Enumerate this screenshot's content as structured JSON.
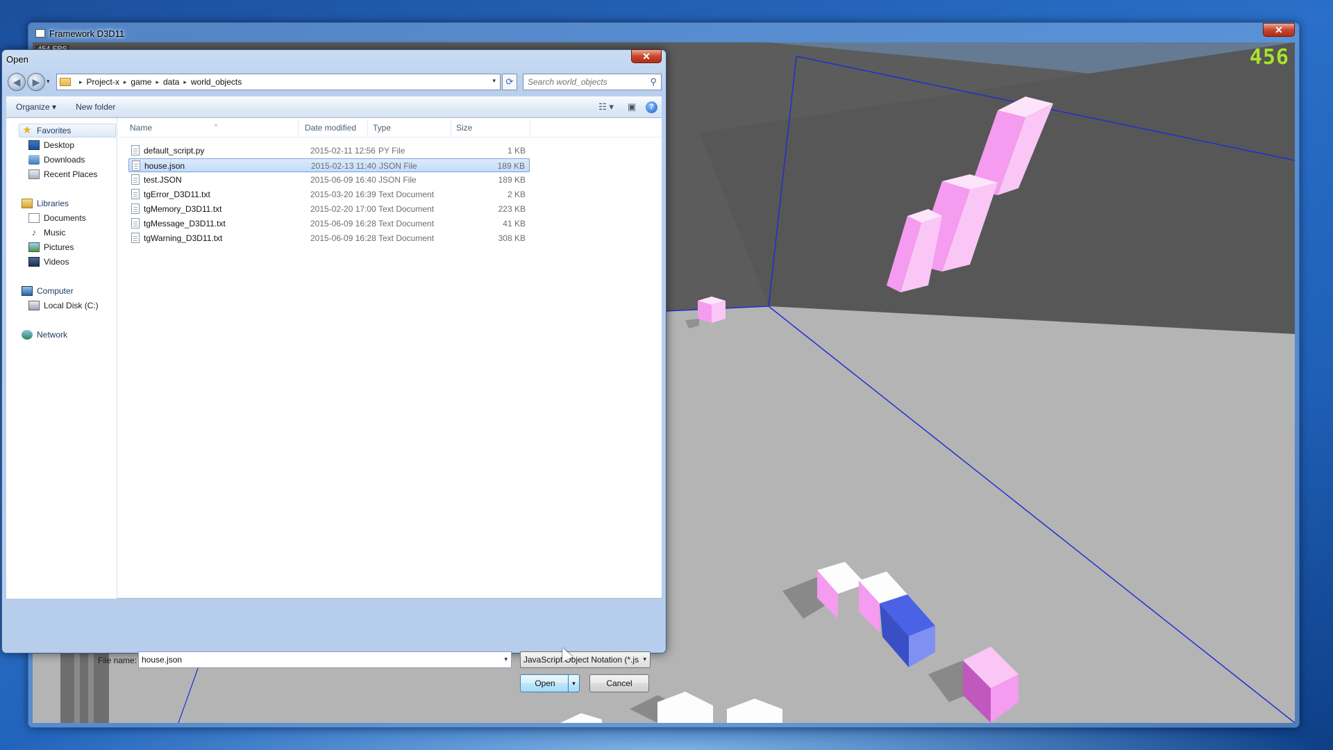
{
  "app_window": {
    "title": "Framework D3D11",
    "close_glyph": "✕",
    "fps_text": "454 FPS",
    "counter": "456"
  },
  "dialog": {
    "title": "Open",
    "close_glyph": "✕",
    "nav": {
      "back": "◀",
      "forward": "▶",
      "history": "▾"
    },
    "breadcrumb": [
      "Project-x",
      "game",
      "data",
      "world_objects"
    ],
    "breadcrumb_separator": "▸",
    "address_dropdown": "▾",
    "refresh_glyph": "⟳",
    "search_placeholder": "Search world_objects",
    "search_glyph": "⚲",
    "toolbar": {
      "organize": "Organize ▾",
      "new_folder": "New folder",
      "view_glyph": "☷ ▾",
      "preview_glyph": "▣",
      "help_glyph": "?"
    },
    "nav_pane": {
      "favorites": "Favorites",
      "desktop": "Desktop",
      "downloads": "Downloads",
      "recent_places": "Recent Places",
      "libraries": "Libraries",
      "documents": "Documents",
      "music": "Music",
      "pictures": "Pictures",
      "videos": "Videos",
      "computer": "Computer",
      "local_disk": "Local Disk (C:)",
      "network": "Network"
    },
    "columns": {
      "name": "Name",
      "date_modified": "Date modified",
      "type": "Type",
      "size": "Size",
      "sort_glyph": "^"
    },
    "files": [
      {
        "name": "default_script.py",
        "date": "2015-02-11 12:56",
        "type": "PY File",
        "size": "1 KB"
      },
      {
        "name": "house.json",
        "date": "2015-02-13 11:40",
        "type": "JSON File",
        "size": "189 KB"
      },
      {
        "name": "test.JSON",
        "date": "2015-06-09 16:40",
        "type": "JSON File",
        "size": "189 KB"
      },
      {
        "name": "tgError_D3D11.txt",
        "date": "2015-03-20 16:39",
        "type": "Text Document",
        "size": "2 KB"
      },
      {
        "name": "tgMemory_D3D11.txt",
        "date": "2015-02-20 17:00",
        "type": "Text Document",
        "size": "223 KB"
      },
      {
        "name": "tgMessage_D3D11.txt",
        "date": "2015-06-09 16:28",
        "type": "Text Document",
        "size": "41 KB"
      },
      {
        "name": "tgWarning_D3D11.txt",
        "date": "2015-06-09 16:28",
        "type": "Text Document",
        "size": "308 KB"
      }
    ],
    "selected_file": "house.json",
    "file_name_label": "File name:",
    "file_name_value": "house.json",
    "file_type_value": "JavaScript Object Notation (*.js",
    "dropdown_glyph": "▾",
    "open_button": "Open",
    "cancel_button": "Cancel"
  },
  "colors": {
    "selection": "#c1dcfc",
    "cube_pink": "#f59bf0",
    "cube_blue": "#4a63e6",
    "floor": "#b4b4b4",
    "wall": "#5c5c5c",
    "counter_green": "#a9e22b"
  }
}
